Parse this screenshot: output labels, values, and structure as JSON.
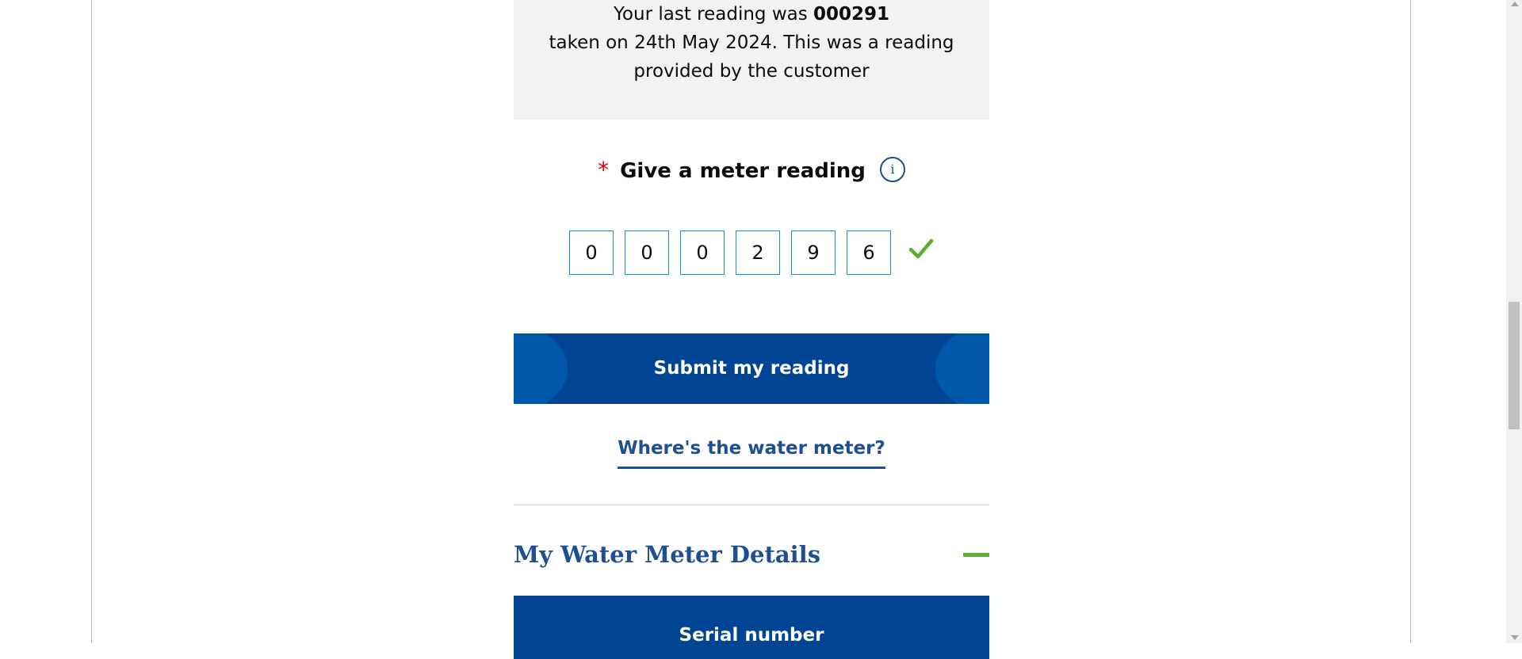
{
  "last_reading": {
    "prefix": "Your last reading was ",
    "value": "000291",
    "line2": "taken on 24th May 2024. This was a reading",
    "line3": "provided by the customer"
  },
  "reading_field": {
    "required_marker": "*",
    "label": "Give a meter reading",
    "info_icon": "info-icon",
    "info_glyph": "i",
    "digits": [
      "0",
      "0",
      "0",
      "2",
      "9",
      "6"
    ],
    "status_icon": "check-icon"
  },
  "submit_label": "Submit my reading",
  "where_link": "Where's the water meter?",
  "details": {
    "title": "My Water Meter Details",
    "toggle_icon": "minus-icon",
    "serial_label": "Serial number"
  },
  "colors": {
    "brand_blue": "#004494",
    "link_blue": "#1d4f91",
    "accent_green": "#5cb02e",
    "required_red": "#e10000",
    "input_border": "#1a8ad4"
  }
}
